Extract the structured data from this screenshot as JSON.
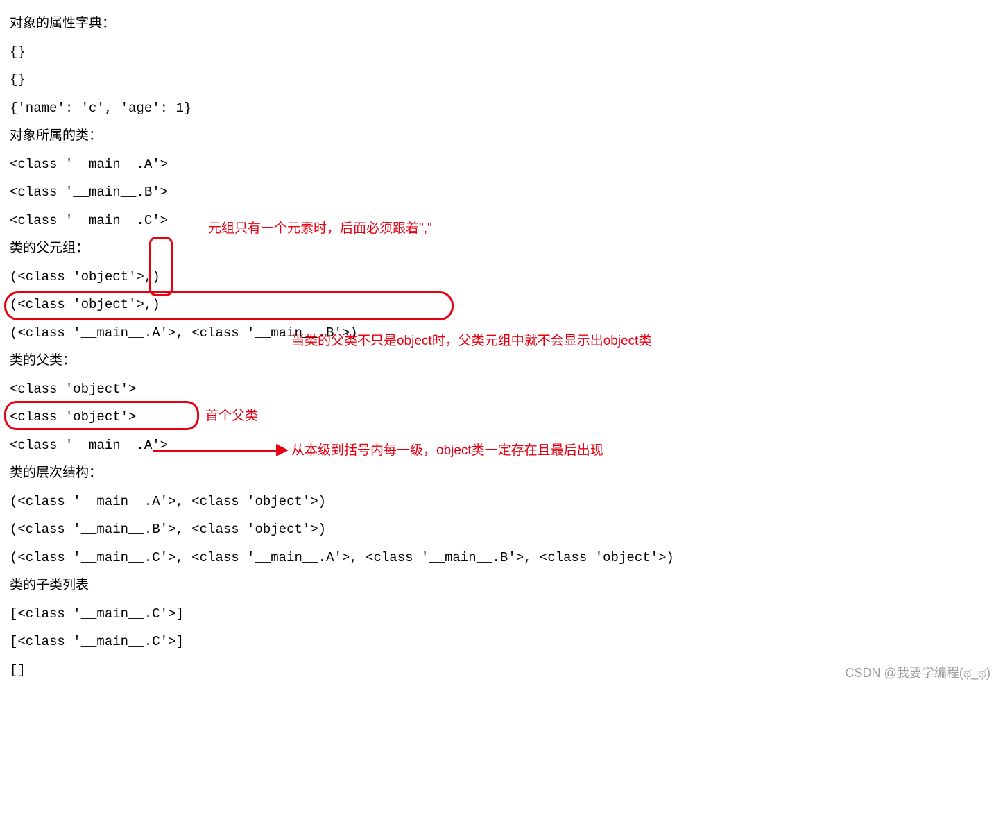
{
  "lines": {
    "l0": "对象的属性字典：",
    "l1": "{}",
    "l2": "{}",
    "l3": "{'name': 'c', 'age': 1}",
    "l4": "对象所属的类：",
    "l5": "<class '__main__.A'>",
    "l6": "<class '__main__.B'>",
    "l7": "<class '__main__.C'>",
    "l8": "类的父元组：",
    "l9": "(<class 'object'>,)",
    "l10": "(<class 'object'>,)",
    "l11": "(<class '__main__.A'>, <class '__main__.B'>)",
    "l12": "类的父类：",
    "l13": "<class 'object'>",
    "l14": "<class 'object'>",
    "l15": "<class '__main__.A'>",
    "l16": "类的层次结构：",
    "l17": "(<class '__main__.A'>, <class 'object'>)",
    "l18": "(<class '__main__.B'>, <class 'object'>)",
    "l19": "(<class '__main__.C'>, <class '__main__.A'>, <class '__main__.B'>, <class 'object'>)",
    "l20": "类的子类列表",
    "l21": "[<class '__main__.C'>]",
    "l22": "[<class '__main__.C'>]",
    "l23": "[]"
  },
  "annotations": {
    "a1": "元组只有一个元素时，后面必须跟着\",\"",
    "a2": "当类的父类不只是object时，父类元组中就不会显示出object类",
    "a3": "首个父类",
    "a4": "从本级到括号内每一级，object类一定存在且最后出现"
  },
  "watermark": "CSDN @我要学编程(ಥ_ಥ)"
}
